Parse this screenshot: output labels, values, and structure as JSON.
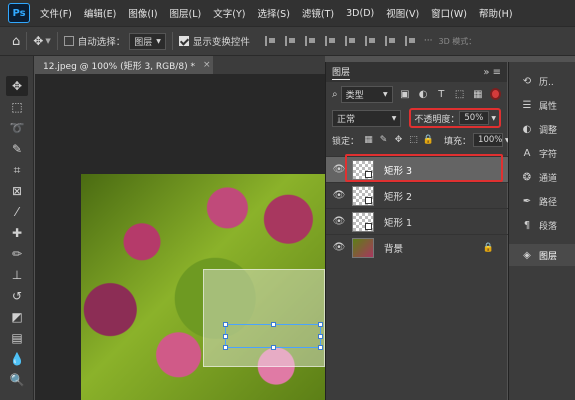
{
  "menubar": {
    "logo": "Ps",
    "items": [
      "文件(F)",
      "编辑(E)",
      "图像(I)",
      "图层(L)",
      "文字(Y)",
      "选择(S)",
      "滤镜(T)",
      "3D(D)",
      "视图(V)",
      "窗口(W)",
      "帮助(H)"
    ]
  },
  "options": {
    "auto_select_label": "自动选择：",
    "auto_select_target": "图层",
    "show_transform_label": "显示变换控件",
    "mode_3d_label": "3D 模式："
  },
  "document": {
    "tab_title": "12.jpeg @ 100% (矩形 3, RGB/8) *"
  },
  "layers_panel": {
    "title": "图层",
    "filter_kind": "类型",
    "blend_mode": "正常",
    "opacity_label": "不透明度：",
    "opacity_value": "50%",
    "lock_label": "锁定：",
    "fill_label": "填充：",
    "fill_value": "100%",
    "layers": [
      {
        "name": "矩形 3",
        "selected": true,
        "type": "shape"
      },
      {
        "name": "矩形 2",
        "selected": false,
        "type": "shape"
      },
      {
        "name": "矩形 1",
        "selected": false,
        "type": "shape"
      },
      {
        "name": "背景",
        "selected": false,
        "type": "image",
        "locked": true
      }
    ]
  },
  "dock": {
    "items": [
      {
        "label": "历..",
        "icon": "history-icon"
      },
      {
        "label": "属性",
        "icon": "properties-icon"
      },
      {
        "label": "调整",
        "icon": "adjustments-icon"
      },
      {
        "label": "字符",
        "icon": "character-icon"
      },
      {
        "label": "通道",
        "icon": "channels-icon"
      },
      {
        "label": "路径",
        "icon": "paths-icon"
      },
      {
        "label": "段落",
        "icon": "paragraph-icon"
      },
      {
        "label": "图层",
        "icon": "layers-icon"
      }
    ]
  },
  "colors": {
    "highlight_red": "#e03030",
    "selection_blue": "#4aa3ff",
    "panel_bg": "#3c3c3c",
    "selected_layer_bg": "#646464"
  }
}
